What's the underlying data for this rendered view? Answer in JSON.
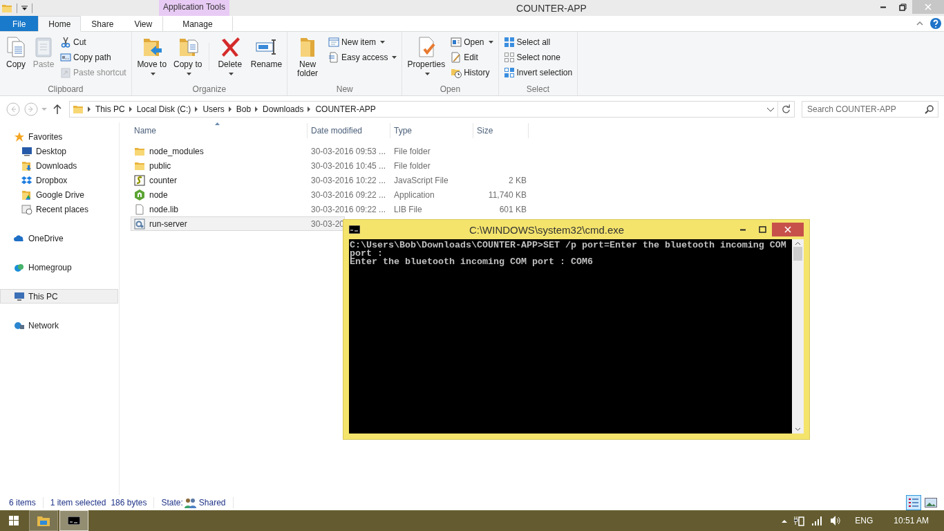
{
  "window": {
    "title": "COUNTER-APP",
    "context_label": "Application Tools"
  },
  "ribbon_tabs": [
    {
      "label": "File",
      "kind": "file",
      "selected": false
    },
    {
      "label": "Home",
      "kind": "tab",
      "selected": true
    },
    {
      "label": "Share",
      "kind": "tab",
      "selected": false
    },
    {
      "label": "View",
      "kind": "tab",
      "selected": false
    },
    {
      "label": "Manage",
      "kind": "context",
      "selected": false
    }
  ],
  "ribbon_groups": [
    {
      "label": "Clipboard",
      "items": [
        {
          "kind": "large",
          "label": "Copy",
          "disabled": false,
          "dropdown": false
        },
        {
          "kind": "large",
          "label": "Paste",
          "disabled": true,
          "dropdown": false
        },
        {
          "kind": "stack",
          "children": [
            {
              "label": "Cut",
              "disabled": false,
              "dropdown": false
            },
            {
              "label": "Copy path",
              "disabled": false,
              "dropdown": false
            },
            {
              "label": "Paste shortcut",
              "disabled": true,
              "dropdown": false
            }
          ]
        }
      ]
    },
    {
      "label": "Organize",
      "items": [
        {
          "kind": "large",
          "label": "Move to",
          "disabled": false,
          "dropdown": true
        },
        {
          "kind": "large",
          "label": "Copy to",
          "disabled": false,
          "dropdown": true
        },
        {
          "kind": "separator"
        },
        {
          "kind": "large",
          "label": "Delete",
          "disabled": false,
          "dropdown": true
        },
        {
          "kind": "large",
          "label": "Rename",
          "disabled": false,
          "dropdown": false
        }
      ]
    },
    {
      "label": "New",
      "items": [
        {
          "kind": "large",
          "label": "New folder",
          "disabled": false,
          "dropdown": false
        },
        {
          "kind": "stack",
          "children": [
            {
              "label": "New item",
              "disabled": false,
              "dropdown": true
            },
            {
              "label": "Easy access",
              "disabled": false,
              "dropdown": true
            }
          ]
        }
      ]
    },
    {
      "label": "Open",
      "items": [
        {
          "kind": "large",
          "label": "Properties",
          "disabled": false,
          "dropdown": true
        },
        {
          "kind": "stack",
          "children": [
            {
              "label": "Open",
              "disabled": false,
              "dropdown": true
            },
            {
              "label": "Edit",
              "disabled": false,
              "dropdown": false
            },
            {
              "label": "History",
              "disabled": false,
              "dropdown": false
            }
          ]
        }
      ]
    },
    {
      "label": "Select",
      "items": [
        {
          "kind": "stack",
          "children": [
            {
              "label": "Select all",
              "disabled": false,
              "dropdown": false
            },
            {
              "label": "Select none",
              "disabled": false,
              "dropdown": false
            },
            {
              "label": "Invert selection",
              "disabled": false,
              "dropdown": false
            }
          ]
        }
      ]
    }
  ],
  "address_bar": {
    "segments": [
      "This PC",
      "Local Disk (C:)",
      "Users",
      "Bob",
      "Downloads",
      "COUNTER-APP"
    ],
    "search_placeholder": "Search COUNTER-APP"
  },
  "navigation": [
    {
      "label": "Favorites",
      "selected": false,
      "children": [
        {
          "label": "Desktop",
          "selected": false
        },
        {
          "label": "Downloads",
          "selected": false
        },
        {
          "label": "Dropbox",
          "selected": false
        },
        {
          "label": "Google Drive",
          "selected": false
        },
        {
          "label": "Recent places",
          "selected": false
        }
      ]
    },
    {
      "label": "OneDrive",
      "selected": false
    },
    {
      "label": "Homegroup",
      "selected": false
    },
    {
      "label": "This PC",
      "selected": true
    },
    {
      "label": "Network",
      "selected": false
    }
  ],
  "file_list": {
    "columns": [
      "Name",
      "Date modified",
      "Type",
      "Size"
    ],
    "rows": [
      {
        "kind": "folder",
        "name": "node_modules",
        "date": "30-03-2016 09:53 ...",
        "type": "File folder",
        "selected": false
      },
      {
        "kind": "folder",
        "name": "public",
        "date": "30-03-2016 10:45 ...",
        "type": "File folder",
        "selected": false
      },
      {
        "kind": "script",
        "name": "counter",
        "date": "30-03-2016 10:22 ...",
        "type": "JavaScript File",
        "size": "2 KB",
        "selected": false
      },
      {
        "kind": "application",
        "name": "node",
        "date": "30-03-2016 09:22 ...",
        "type": "Application",
        "size": "11,740 KB",
        "selected": false
      },
      {
        "kind": "file",
        "name": "node.lib",
        "date": "30-03-2016 09:22 ...",
        "type": "LIB File",
        "size": "601 KB",
        "selected": false
      },
      {
        "kind": "batch",
        "name": "run-server",
        "date": "30-03-20",
        "selected": true
      }
    ]
  },
  "status_bar": {
    "item_count": "6 items",
    "selection": "1 item selected",
    "selection_size": "186 bytes",
    "state_label": "State:",
    "state_value": "Shared",
    "views": [
      {
        "kind": "details",
        "selected": true
      },
      {
        "kind": "large_icons",
        "selected": false
      }
    ]
  },
  "console": {
    "title": "C:\\WINDOWS\\system32\\cmd.exe",
    "lines": [
      "C:\\Users\\Bob\\Downloads\\COUNTER-APP>SET /p port=Enter the bluetooth incoming COM",
      "port :",
      "Enter the bluetooth incoming COM port : COM6"
    ]
  },
  "taskbar": {
    "apps": [
      {
        "kind": "explorer",
        "selected": false
      },
      {
        "kind": "console",
        "selected": true
      }
    ],
    "language": "ENG",
    "time": "10:51 AM"
  }
}
